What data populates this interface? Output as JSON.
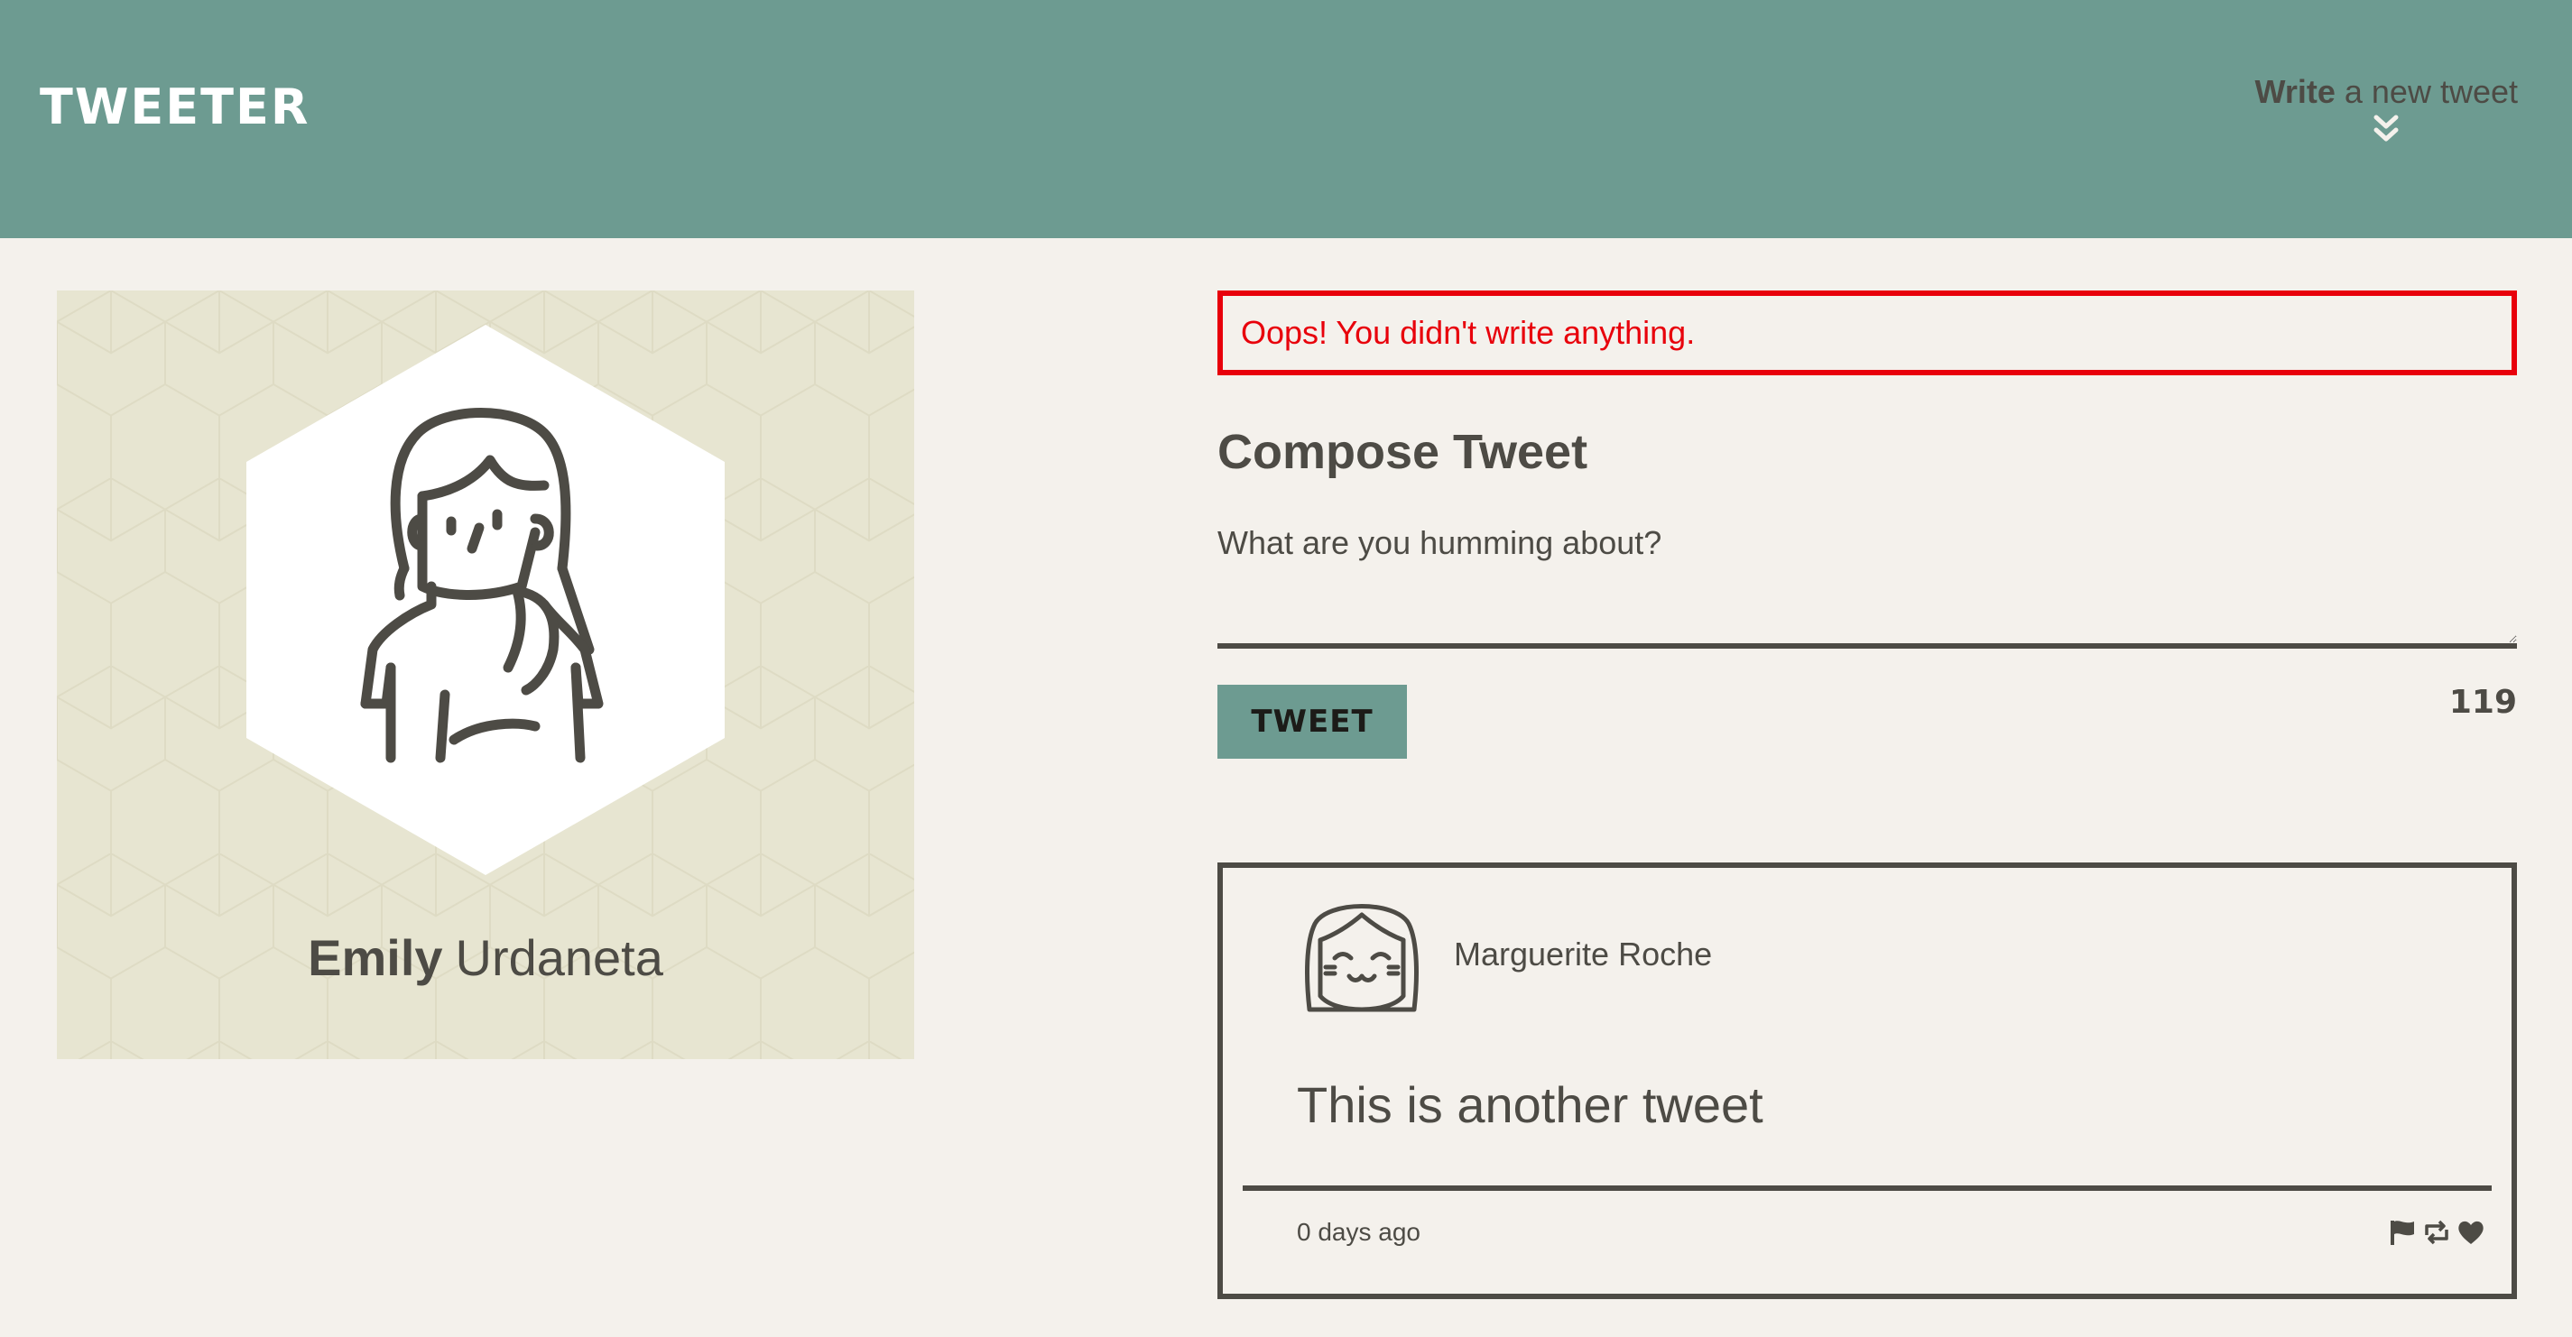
{
  "header": {
    "brand": "TWEETER",
    "compose_toggle": {
      "bold": "Write",
      "light": "a new tweet",
      "icon": "double-chevron-down-icon"
    }
  },
  "profile": {
    "first_name": "Emily",
    "last_name": "Urdaneta",
    "avatar_icon": "woman-avatar-icon"
  },
  "compose": {
    "error": "Oops! You didn't write anything.",
    "title": "Compose Tweet",
    "placeholder": "What are you humming about?",
    "value": "",
    "button_label": "TWEET",
    "counter": "119"
  },
  "tweets": [
    {
      "author": "Marguerite Roche",
      "avatar_icon": "girl-avatar-icon",
      "content": "This is another tweet",
      "timestamp": "0 days ago",
      "actions": [
        "flag-icon",
        "retweet-icon",
        "heart-icon"
      ]
    }
  ],
  "colors": {
    "nav": "#6d9b91",
    "background": "#f4f1ec",
    "profile_bg": "#e7e5d1",
    "text": "#4d4b45",
    "error": "#e8000b"
  }
}
